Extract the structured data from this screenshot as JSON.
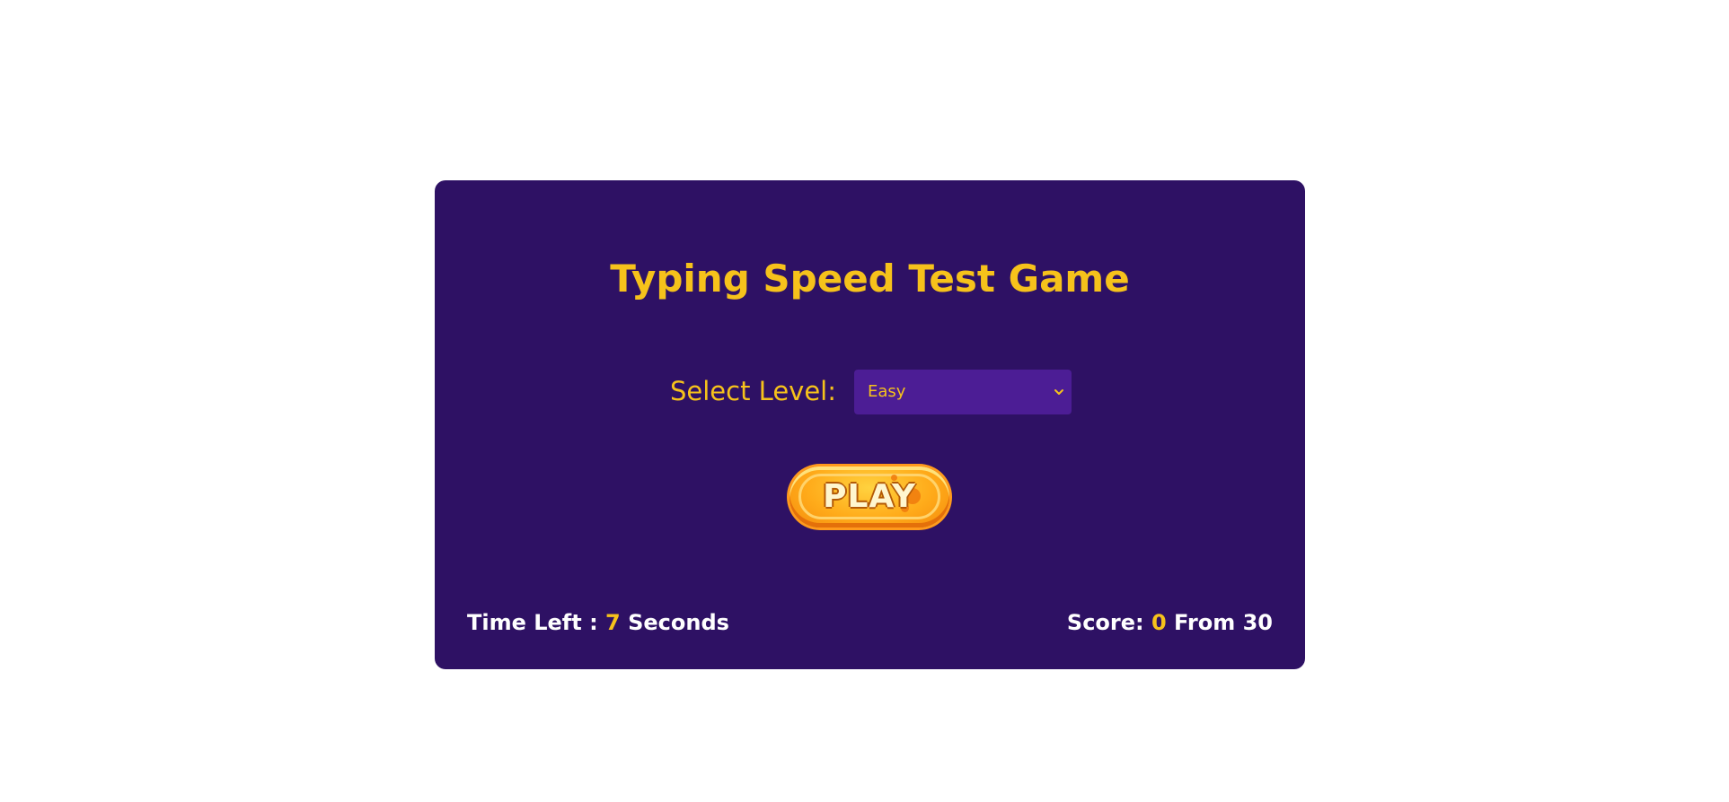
{
  "game": {
    "title": "Typing Speed Test Game",
    "level": {
      "label": "Select Level:",
      "selected": "Easy",
      "chevron_icon": "chevron-down-icon"
    },
    "play_button": {
      "label": "PLAY"
    },
    "time": {
      "prefix": "Time Left :",
      "value": "7",
      "suffix": "Seconds"
    },
    "score": {
      "prefix": "Score:",
      "value": "0",
      "suffix": "From 30"
    }
  },
  "colors": {
    "card_background": "#2e1164",
    "accent": "#f6c21b",
    "select_background": "#4c1d95",
    "play_button": "#ffab1a"
  }
}
